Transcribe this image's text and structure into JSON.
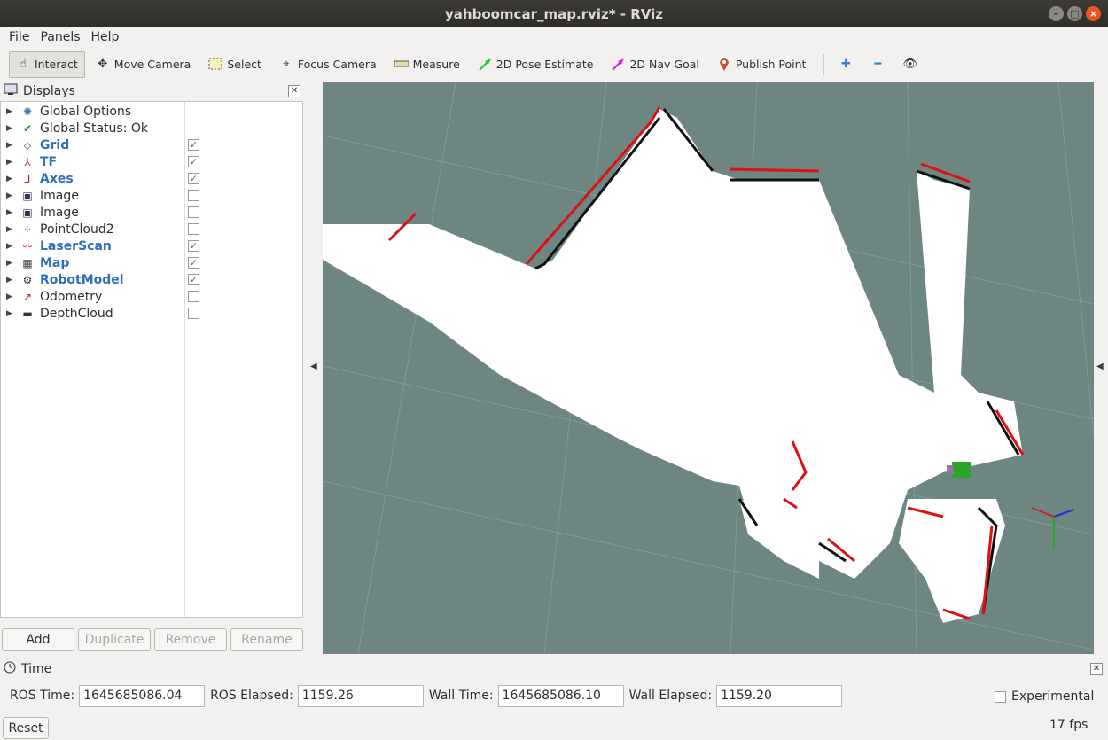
{
  "window": {
    "title": "yahboomcar_map.rviz* - RViz"
  },
  "menu": [
    "File",
    "Panels",
    "Help"
  ],
  "toolbar": {
    "tools": [
      {
        "label": "Interact",
        "icon": "hand-icon",
        "active": true
      },
      {
        "label": "Move Camera",
        "icon": "move-icon"
      },
      {
        "label": "Select",
        "icon": "select-icon"
      },
      {
        "label": "Focus Camera",
        "icon": "target-icon"
      },
      {
        "label": "Measure",
        "icon": "ruler-icon"
      },
      {
        "label": "2D Pose Estimate",
        "icon": "green-arrow-icon"
      },
      {
        "label": "2D Nav Goal",
        "icon": "magenta-arrow-icon"
      },
      {
        "label": "Publish Point",
        "icon": "pin-icon"
      }
    ]
  },
  "displays": {
    "title": "Displays",
    "items": [
      {
        "label": "Global Options",
        "icon": "gear-icon",
        "highlight": false,
        "checkbox": null
      },
      {
        "label": "Global Status: Ok",
        "icon": "check-icon",
        "highlight": false,
        "checkbox": null
      },
      {
        "label": "Grid",
        "icon": "grid-icon",
        "highlight": true,
        "checkbox": true
      },
      {
        "label": "TF",
        "icon": "tf-icon",
        "highlight": true,
        "checkbox": true
      },
      {
        "label": "Axes",
        "icon": "axes-icon",
        "highlight": true,
        "checkbox": true
      },
      {
        "label": "Image",
        "icon": "image-icon",
        "highlight": false,
        "checkbox": false
      },
      {
        "label": "Image",
        "icon": "image-icon",
        "highlight": false,
        "checkbox": false
      },
      {
        "label": "PointCloud2",
        "icon": "pointcloud-icon",
        "highlight": false,
        "checkbox": false
      },
      {
        "label": "LaserScan",
        "icon": "laserscan-icon",
        "highlight": true,
        "checkbox": true
      },
      {
        "label": "Map",
        "icon": "map-icon",
        "highlight": true,
        "checkbox": true
      },
      {
        "label": "RobotModel",
        "icon": "robot-icon",
        "highlight": true,
        "checkbox": true
      },
      {
        "label": "Odometry",
        "icon": "odometry-icon",
        "highlight": false,
        "checkbox": false
      },
      {
        "label": "DepthCloud",
        "icon": "depthcloud-icon",
        "highlight": false,
        "checkbox": false
      }
    ],
    "buttons": {
      "add": "Add",
      "duplicate": "Duplicate",
      "remove": "Remove",
      "rename": "Rename"
    }
  },
  "time": {
    "title": "Time",
    "ros_time_label": "ROS Time:",
    "ros_time": "1645685086.04",
    "ros_elapsed_label": "ROS Elapsed:",
    "ros_elapsed": "1159.26",
    "wall_time_label": "Wall Time:",
    "wall_time": "1645685086.10",
    "wall_elapsed_label": "Wall Elapsed:",
    "wall_elapsed": "1159.20",
    "experimental_label": "Experimental",
    "reset_label": "Reset",
    "fps": "17 fps"
  },
  "colors": {
    "viewport_bg": "#6e8682",
    "highlight_text": "#2f6fb5",
    "laser": "#e01010"
  }
}
